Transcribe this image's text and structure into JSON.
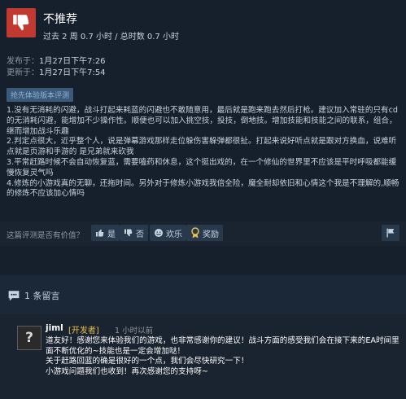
{
  "review": {
    "verdict": "不推荐",
    "hours": "过去 2 周 0.7 小时 / 总时数 0.7 小时",
    "posted_label": "发布于：",
    "posted_value": "1月27日下午7:26",
    "updated_label": "更新于：",
    "updated_value": "1月27日下午7:54",
    "badge": "抢先体验版本评测",
    "paragraphs": [
      "1.没有无消耗的闪避，战斗打起来耗蓝的闪避也不敢随意用，最后就是跑来跑去然后打枪。建议加入常驻的只有cd的无消耗闪避，能增加不少操作性。顺便也可以加入挑空技，投技，倒地技。增加技能和技能之间的联系，组合，继而增加战斗乐趣",
      "2.判定点很大，近乎整个人，说是弹幕游戏那样走位躲伤害躲弹都很扯。打起来说好听点就是跟对方换血，说难听点就是页游和手游的 是兄弟就来砍我",
      "3.平常赶路时候不会自动恢复蓝，需要嗑药和休息，这个挺出戏的，在一个修仙的世界里不应该是平时呼吸都能缓慢恢复灵气吗",
      "4.修炼的小游戏真的无聊，还拖时间。另外对于修炼小游戏我倍全险，魔全耐却依旧和心情这个我是不理解的,顺畅的修炼不应该加心情吗"
    ],
    "colors": {
      "thumb_down": "#c03a32",
      "badge_bg": "#3b5a7a",
      "dev_tag": "#e5c04a"
    }
  },
  "helpful": {
    "question": "这篇评测是否有价值？",
    "yes": "是",
    "no": "否",
    "funny": "欢乐",
    "award": "奖励"
  },
  "comments": {
    "count_label": "1 条留言",
    "items": [
      {
        "author": "jiml",
        "tag": "[开发者]",
        "time": "1 小时以前",
        "avatar_glyph": "?",
        "lines": [
          "道友好！感谢您来体验我们的游戏，也非常感谢你的建议！战斗方面的感受我们会在接下来的EA时间里面不断优化的~技能也是一定会增加哒！",
          "关于赶路回蓝的确是很好的一个点，我们会尽快研究一下！",
          "小游戏问题我们也收到！再次感谢您的支持呀~"
        ]
      }
    ]
  }
}
